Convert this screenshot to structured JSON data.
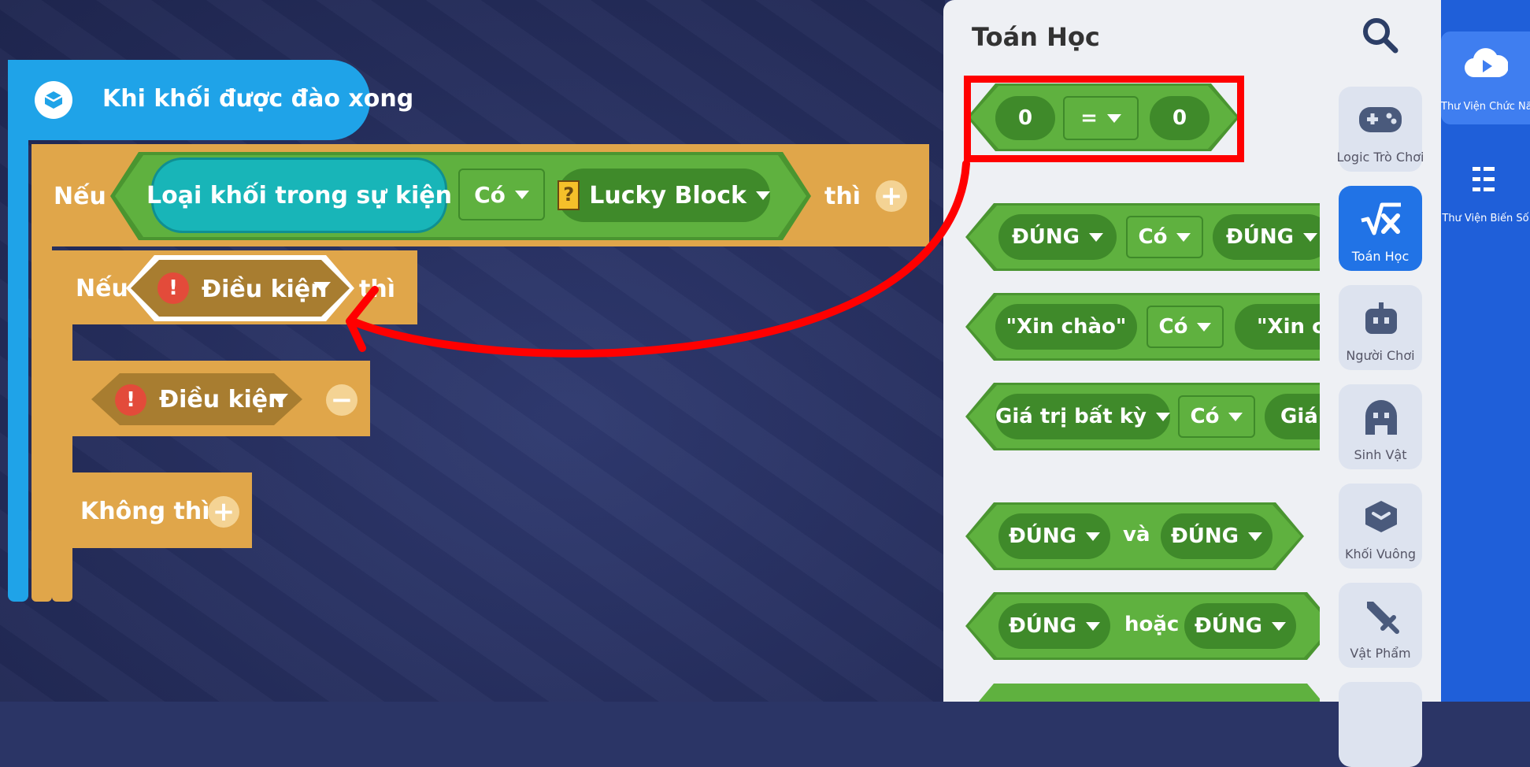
{
  "workspace": {
    "event_block": {
      "label": "Khi khối được đào xong",
      "icon": "cube-icon"
    },
    "if_block_outer": {
      "keyword": "Nếu",
      "then": "thì",
      "condition": {
        "left": "Loại khối trong sự kiện",
        "operator": "Có",
        "right": "Lucky Block",
        "right_icon": "lucky-block-icon"
      }
    },
    "if_block_inner": {
      "keyword": "Nếu",
      "then": "thì",
      "condition": "Điều kiện"
    },
    "elseif_condition": "Điều kiện",
    "else_label": "Không thì"
  },
  "palette": {
    "title": "Toán Học",
    "compare_block": {
      "left": "0",
      "operator": "=",
      "right": "0"
    },
    "rows": [
      {
        "left": "ĐÚNG",
        "op": "Có",
        "right": "ĐÚNG"
      },
      {
        "left": "\"Xin chào\"",
        "op": "Có",
        "right": "\"Xin ch"
      },
      {
        "left": "Giá trị bất kỳ",
        "op": "Có",
        "right": "Giá t"
      }
    ],
    "and_block": {
      "left": "ĐÚNG",
      "word": "và",
      "right": "ĐÚNG"
    },
    "or_block": {
      "left": "ĐÚNG",
      "word": "hoặc",
      "right": "ĐÚNG"
    }
  },
  "categories": [
    {
      "label": "Logic Trò Chơi",
      "icon": "gamepad-icon"
    },
    {
      "label": "Toán Học",
      "icon": "math-icon"
    },
    {
      "label": "Người Chơi",
      "icon": "robot-icon"
    },
    {
      "label": "Sinh Vật",
      "icon": "creature-icon"
    },
    {
      "label": "Khối Vuông",
      "icon": "cube-icon"
    },
    {
      "label": "Vật Phẩm",
      "icon": "sword-icon"
    }
  ],
  "library": {
    "function_label": "Thư Viện Chức Năng",
    "variable_label": "Thư Viện Biến Số"
  },
  "colors": {
    "event": "#1fa3e8",
    "control": "#e0a64a",
    "logic_green": "#5fb13f",
    "annotation_red": "#ff0000",
    "active_category": "#2173e6"
  }
}
